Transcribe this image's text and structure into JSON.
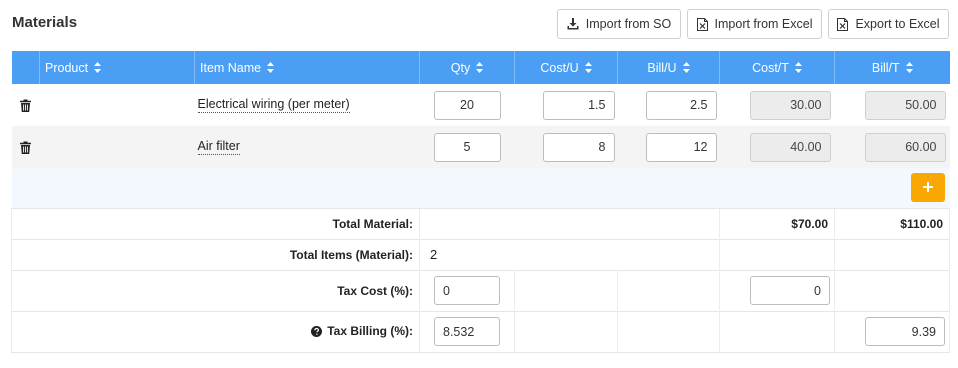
{
  "page": {
    "title": "Materials"
  },
  "toolbar": {
    "import_so": "Import from SO",
    "import_excel": "Import from Excel",
    "export_excel": "Export to Excel"
  },
  "columns": {
    "product": "Product",
    "item_name": "Item Name",
    "qty": "Qty",
    "cost_u": "Cost/U",
    "bill_u": "Bill/U",
    "cost_t": "Cost/T",
    "bill_t": "Bill/T"
  },
  "rows": [
    {
      "product": "",
      "item_name": "Electrical wiring (per meter)",
      "qty": "20",
      "cost_u": "1.5",
      "bill_u": "2.5",
      "cost_t": "30.00",
      "bill_t": "50.00"
    },
    {
      "product": "",
      "item_name": "Air filter",
      "qty": "5",
      "cost_u": "8",
      "bill_u": "12",
      "cost_t": "40.00",
      "bill_t": "60.00"
    }
  ],
  "summary": {
    "total_material_label": "Total Material:",
    "total_cost": "$70.00",
    "total_bill": "$110.00",
    "total_items_label": "Total Items (Material):",
    "total_items": "2",
    "tax_cost_label": "Tax Cost (%):",
    "tax_cost_pct": "0",
    "tax_cost_value": "0",
    "tax_billing_label": "Tax Billing (%):",
    "tax_billing_pct": "8.532",
    "tax_billing_value": "9.39"
  },
  "icons": {
    "trash": "trash-icon",
    "add": "plus-icon",
    "download": "download-icon",
    "excel": "excel-file-icon",
    "help": "question-circle-icon",
    "sort": "sort-icon"
  },
  "colors": {
    "header": "#4a9ff5",
    "add_button": "#f8a800",
    "readonly": "#ececec"
  }
}
